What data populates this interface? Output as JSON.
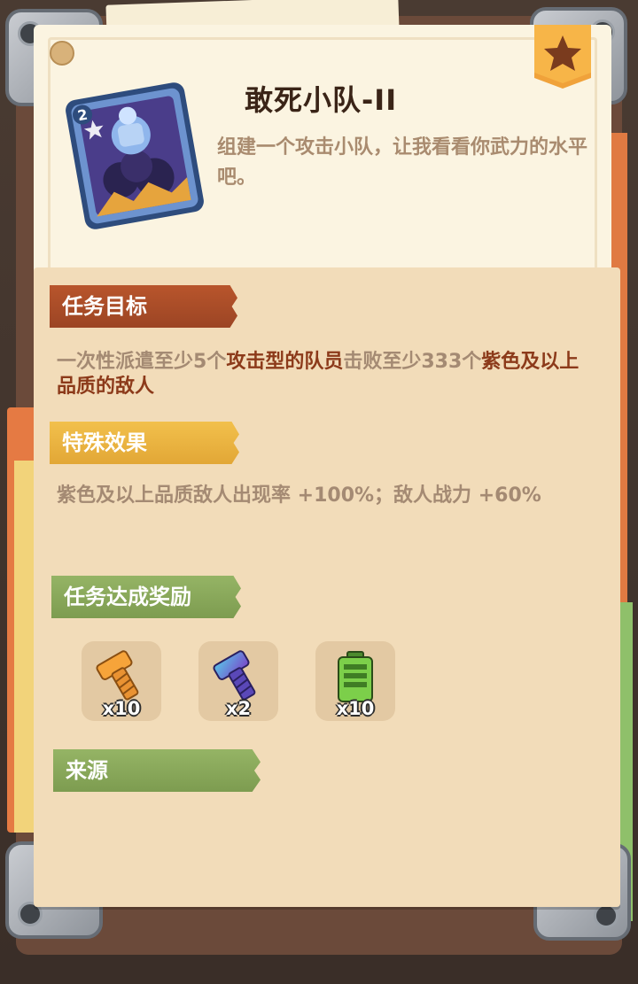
{
  "card": {
    "level": "2",
    "title": "敢死小队-II",
    "description": "组建一个攻击小队，让我看看你武力的水平吧。"
  },
  "objective": {
    "label": "任务目标",
    "text_parts": [
      "一次性派遣至少5个",
      "攻击型的队员",
      "击败至少333个",
      "紫色及以上品质的敌人"
    ]
  },
  "effect": {
    "label": "特殊效果",
    "text": "紫色及以上品质敌人出现率 +100%；敌人战力 +60%"
  },
  "rewards": {
    "label": "任务达成奖励",
    "items": [
      {
        "icon": "gold-bolt-icon",
        "qty": "x10"
      },
      {
        "icon": "purple-bolt-icon",
        "qty": "x2"
      },
      {
        "icon": "green-battery-icon",
        "qty": "x10"
      }
    ]
  },
  "source": {
    "label": "来源"
  },
  "colors": {
    "objective_tag": "#b8552c",
    "effect_tag": "#f2c04c",
    "reward_tag": "#95b465",
    "highlight": "#8c3a1a",
    "panel": "#f2dcb9"
  }
}
